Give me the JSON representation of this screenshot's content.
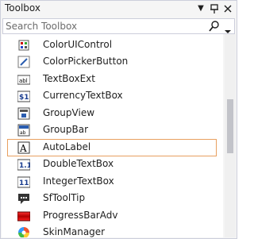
{
  "window": {
    "title": "Toolbox"
  },
  "search": {
    "placeholder": "Search Toolbox"
  },
  "items": [
    {
      "label": "ColorUIControl",
      "icon": "color-ui-control-icon"
    },
    {
      "label": "ColorPickerButton",
      "icon": "color-picker-button-icon"
    },
    {
      "label": "TextBoxExt",
      "icon": "textbox-ext-icon"
    },
    {
      "label": "CurrencyTextBox",
      "icon": "currency-textbox-icon"
    },
    {
      "label": "GroupView",
      "icon": "group-view-icon"
    },
    {
      "label": "GroupBar",
      "icon": "group-bar-icon"
    },
    {
      "label": "AutoLabel",
      "icon": "auto-label-icon"
    },
    {
      "label": "DoubleTextBox",
      "icon": "double-textbox-icon"
    },
    {
      "label": "IntegerTextBox",
      "icon": "integer-textbox-icon"
    },
    {
      "label": "SfToolTip",
      "icon": "sf-tooltip-icon"
    },
    {
      "label": "ProgressBarAdv",
      "icon": "progress-bar-adv-icon"
    },
    {
      "label": "SkinManager",
      "icon": "skin-manager-icon"
    }
  ],
  "selected_item": "AutoLabel",
  "colors": {
    "selection_border": "#e8a060",
    "chrome_background": "#f5f5f5"
  }
}
